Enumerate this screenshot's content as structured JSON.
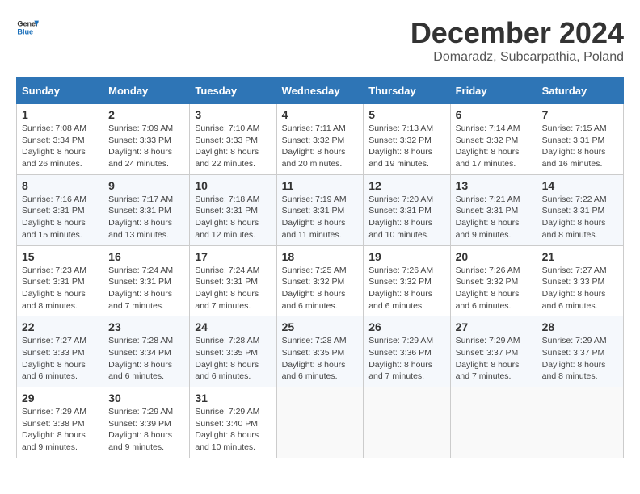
{
  "header": {
    "logo_general": "General",
    "logo_blue": "Blue",
    "month_title": "December 2024",
    "location": "Domaradz, Subcarpathia, Poland"
  },
  "calendar": {
    "days_of_week": [
      "Sunday",
      "Monday",
      "Tuesday",
      "Wednesday",
      "Thursday",
      "Friday",
      "Saturday"
    ],
    "weeks": [
      [
        null,
        {
          "day": "1",
          "sunrise": "7:08 AM",
          "sunset": "3:34 PM",
          "daylight": "8 hours and 26 minutes."
        },
        {
          "day": "2",
          "sunrise": "7:09 AM",
          "sunset": "3:33 PM",
          "daylight": "8 hours and 24 minutes."
        },
        {
          "day": "3",
          "sunrise": "7:10 AM",
          "sunset": "3:33 PM",
          "daylight": "8 hours and 22 minutes."
        },
        {
          "day": "4",
          "sunrise": "7:11 AM",
          "sunset": "3:32 PM",
          "daylight": "8 hours and 20 minutes."
        },
        {
          "day": "5",
          "sunrise": "7:13 AM",
          "sunset": "3:32 PM",
          "daylight": "8 hours and 19 minutes."
        },
        {
          "day": "6",
          "sunrise": "7:14 AM",
          "sunset": "3:32 PM",
          "daylight": "8 hours and 17 minutes."
        },
        {
          "day": "7",
          "sunrise": "7:15 AM",
          "sunset": "3:31 PM",
          "daylight": "8 hours and 16 minutes."
        }
      ],
      [
        {
          "day": "8",
          "sunrise": "7:16 AM",
          "sunset": "3:31 PM",
          "daylight": "8 hours and 15 minutes."
        },
        {
          "day": "9",
          "sunrise": "7:17 AM",
          "sunset": "3:31 PM",
          "daylight": "8 hours and 13 minutes."
        },
        {
          "day": "10",
          "sunrise": "7:18 AM",
          "sunset": "3:31 PM",
          "daylight": "8 hours and 12 minutes."
        },
        {
          "day": "11",
          "sunrise": "7:19 AM",
          "sunset": "3:31 PM",
          "daylight": "8 hours and 11 minutes."
        },
        {
          "day": "12",
          "sunrise": "7:20 AM",
          "sunset": "3:31 PM",
          "daylight": "8 hours and 10 minutes."
        },
        {
          "day": "13",
          "sunrise": "7:21 AM",
          "sunset": "3:31 PM",
          "daylight": "8 hours and 9 minutes."
        },
        {
          "day": "14",
          "sunrise": "7:22 AM",
          "sunset": "3:31 PM",
          "daylight": "8 hours and 8 minutes."
        }
      ],
      [
        {
          "day": "15",
          "sunrise": "7:23 AM",
          "sunset": "3:31 PM",
          "daylight": "8 hours and 8 minutes."
        },
        {
          "day": "16",
          "sunrise": "7:24 AM",
          "sunset": "3:31 PM",
          "daylight": "8 hours and 7 minutes."
        },
        {
          "day": "17",
          "sunrise": "7:24 AM",
          "sunset": "3:31 PM",
          "daylight": "8 hours and 7 minutes."
        },
        {
          "day": "18",
          "sunrise": "7:25 AM",
          "sunset": "3:32 PM",
          "daylight": "8 hours and 6 minutes."
        },
        {
          "day": "19",
          "sunrise": "7:26 AM",
          "sunset": "3:32 PM",
          "daylight": "8 hours and 6 minutes."
        },
        {
          "day": "20",
          "sunrise": "7:26 AM",
          "sunset": "3:32 PM",
          "daylight": "8 hours and 6 minutes."
        },
        {
          "day": "21",
          "sunrise": "7:27 AM",
          "sunset": "3:33 PM",
          "daylight": "8 hours and 6 minutes."
        }
      ],
      [
        {
          "day": "22",
          "sunrise": "7:27 AM",
          "sunset": "3:33 PM",
          "daylight": "8 hours and 6 minutes."
        },
        {
          "day": "23",
          "sunrise": "7:28 AM",
          "sunset": "3:34 PM",
          "daylight": "8 hours and 6 minutes."
        },
        {
          "day": "24",
          "sunrise": "7:28 AM",
          "sunset": "3:35 PM",
          "daylight": "8 hours and 6 minutes."
        },
        {
          "day": "25",
          "sunrise": "7:28 AM",
          "sunset": "3:35 PM",
          "daylight": "8 hours and 6 minutes."
        },
        {
          "day": "26",
          "sunrise": "7:29 AM",
          "sunset": "3:36 PM",
          "daylight": "8 hours and 7 minutes."
        },
        {
          "day": "27",
          "sunrise": "7:29 AM",
          "sunset": "3:37 PM",
          "daylight": "8 hours and 7 minutes."
        },
        {
          "day": "28",
          "sunrise": "7:29 AM",
          "sunset": "3:37 PM",
          "daylight": "8 hours and 8 minutes."
        }
      ],
      [
        {
          "day": "29",
          "sunrise": "7:29 AM",
          "sunset": "3:38 PM",
          "daylight": "8 hours and 9 minutes."
        },
        {
          "day": "30",
          "sunrise": "7:29 AM",
          "sunset": "3:39 PM",
          "daylight": "8 hours and 9 minutes."
        },
        {
          "day": "31",
          "sunrise": "7:29 AM",
          "sunset": "3:40 PM",
          "daylight": "8 hours and 10 minutes."
        },
        null,
        null,
        null,
        null
      ]
    ]
  }
}
